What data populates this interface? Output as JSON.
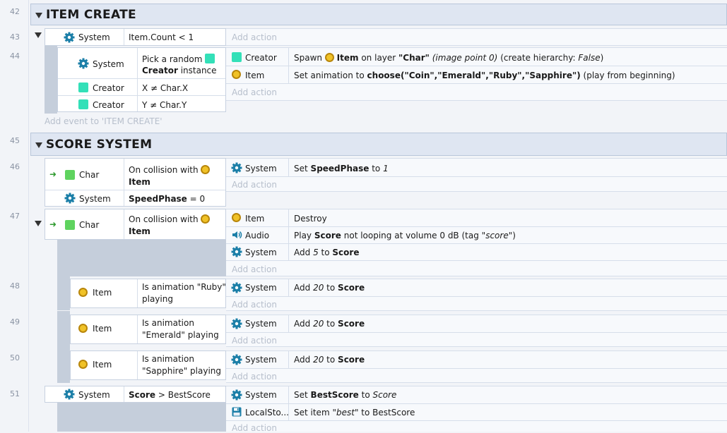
{
  "colors": {
    "creator": "#33e0b8",
    "char": "#5fd35f",
    "coin": "#f0c227"
  },
  "line_numbers": [
    "42",
    "43",
    "44",
    "45",
    "46",
    "47",
    "48",
    "49",
    "50",
    "51"
  ],
  "groups": {
    "item_create": "ITEM CREATE",
    "score_system": "SCORE SYSTEM"
  },
  "common": {
    "add_action": "Add action",
    "add_event_item_create": "Add event to 'ITEM CREATE'"
  },
  "objects": {
    "system": "System",
    "creator": "Creator",
    "item": "Item",
    "char": "Char",
    "audio": "Audio",
    "localsto": "LocalSto..."
  },
  "e43": {
    "cond": "Item.Count < 1"
  },
  "e44": {
    "cond1_a": "Pick a random",
    "cond1_b": "Creator",
    "cond1_c": "instance",
    "cond2": "X ≠ Char.X",
    "cond3": "Y ≠ Char.Y",
    "act1_a": "Spawn",
    "act1_b": "Item",
    "act1_c": "on layer",
    "act1_d": "\"Char\"",
    "act1_e": "(image point 0)",
    "act1_f": "(create hierarchy:",
    "act1_g": "False",
    "act2_a": "Set animation to",
    "act2_b": "choose(\"Coin\",\"Emerald\",\"Ruby\",\"Sapphire\")",
    "act2_c": "(play from beginning)"
  },
  "e46": {
    "cond1_a": "On collision with",
    "cond1_b": "Item",
    "cond2_a": "SpeedPhase",
    "cond2_b": "= 0",
    "act1_a": "Set",
    "act1_b": "SpeedPhase",
    "act1_c": "to",
    "act1_d": "1"
  },
  "e47": {
    "cond_a": "On collision with",
    "cond_b": "Item",
    "act1": "Destroy",
    "act2_a": "Play",
    "act2_b": "Score",
    "act2_c": "not looping at volume 0 dB (tag",
    "act2_d": "\"score\"",
    "act2_e": ")",
    "act3_a": "Add",
    "act3_b": "5",
    "act3_c": "to",
    "act3_d": "Score"
  },
  "e48": {
    "cond_a": "Is animation \"Ruby\"",
    "cond_b": "playing",
    "act_a": "Add",
    "act_b": "20",
    "act_c": "to",
    "act_d": "Score"
  },
  "e49": {
    "cond_a": "Is animation",
    "cond_b": "\"Emerald\" playing",
    "act_a": "Add",
    "act_b": "20",
    "act_c": "to",
    "act_d": "Score"
  },
  "e50": {
    "cond_a": "Is animation",
    "cond_b": "\"Sapphire\" playing",
    "act_a": "Add",
    "act_b": "20",
    "act_c": "to",
    "act_d": "Score"
  },
  "e51": {
    "cond_a": "Score",
    "cond_b": "> BestScore",
    "act1_a": "Set",
    "act1_b": "BestScore",
    "act1_c": "to",
    "act1_d": "Score",
    "act2_a": "Set item",
    "act2_b": "\"best\"",
    "act2_c": "to BestScore"
  }
}
